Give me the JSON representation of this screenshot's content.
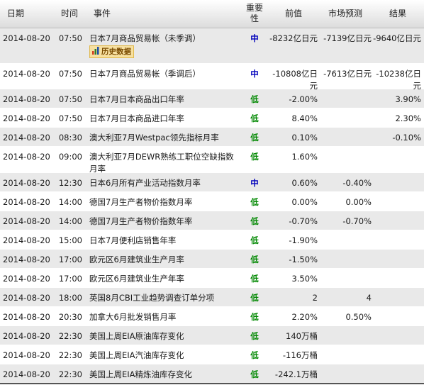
{
  "columns": {
    "date": "日期",
    "time": "时间",
    "event": "事件",
    "importance": "重要性",
    "previous": "前值",
    "forecast": "市场预测",
    "actual": "结果"
  },
  "history_label": "历史数据",
  "importance_colors": {
    "high": "#0000bb",
    "low": "#008800"
  },
  "rows": [
    {
      "date": "2014-08-20",
      "time": "07:50",
      "event": "日本7月商品贸易帐（未季调）",
      "importance": "中",
      "level": "high",
      "previous": "-8232亿日元",
      "forecast": "-7139亿日元",
      "actual": "-9640亿日元",
      "history": true
    },
    {
      "date": "2014-08-20",
      "time": "07:50",
      "event": "日本7月商品贸易帐（季调后）",
      "importance": "中",
      "level": "high",
      "previous": "-10808亿日元",
      "forecast": "-7613亿日元",
      "actual": "-10238亿日元"
    },
    {
      "date": "2014-08-20",
      "time": "07:50",
      "event": "日本7月日本商品出口年率",
      "importance": "低",
      "level": "low",
      "previous": "-2.00%",
      "forecast": "",
      "actual": "3.90%"
    },
    {
      "date": "2014-08-20",
      "time": "07:50",
      "event": "日本7月日本商品进口年率",
      "importance": "低",
      "level": "low",
      "previous": "8.40%",
      "forecast": "",
      "actual": "2.30%"
    },
    {
      "date": "2014-08-20",
      "time": "08:30",
      "event": "澳大利亚7月Westpac领先指标月率",
      "importance": "低",
      "level": "low",
      "previous": "0.10%",
      "forecast": "",
      "actual": "-0.10%"
    },
    {
      "date": "2014-08-20",
      "time": "09:00",
      "event": "澳大利亚7月DEWR熟练工职位空缺指数月率",
      "importance": "低",
      "level": "low",
      "previous": "1.60%",
      "forecast": "",
      "actual": ""
    },
    {
      "date": "2014-08-20",
      "time": "12:30",
      "event": "日本6月所有产业活动指数月率",
      "importance": "中",
      "level": "high",
      "previous": "0.60%",
      "forecast": "-0.40%",
      "actual": ""
    },
    {
      "date": "2014-08-20",
      "time": "14:00",
      "event": "德国7月生产者物价指数月率",
      "importance": "低",
      "level": "low",
      "previous": "0.00%",
      "forecast": "0.00%",
      "actual": ""
    },
    {
      "date": "2014-08-20",
      "time": "14:00",
      "event": "德国7月生产者物价指数年率",
      "importance": "低",
      "level": "low",
      "previous": "-0.70%",
      "forecast": "-0.70%",
      "actual": ""
    },
    {
      "date": "2014-08-20",
      "time": "15:00",
      "event": "日本7月便利店销售年率",
      "importance": "低",
      "level": "low",
      "previous": "-1.90%",
      "forecast": "",
      "actual": ""
    },
    {
      "date": "2014-08-20",
      "time": "17:00",
      "event": "欧元区6月建筑业生产月率",
      "importance": "低",
      "level": "low",
      "previous": "-1.50%",
      "forecast": "",
      "actual": ""
    },
    {
      "date": "2014-08-20",
      "time": "17:00",
      "event": "欧元区6月建筑业生产年率",
      "importance": "低",
      "level": "low",
      "previous": "3.50%",
      "forecast": "",
      "actual": ""
    },
    {
      "date": "2014-08-20",
      "time": "18:00",
      "event": "英国8月CBI工业趋势调查订单分项",
      "importance": "低",
      "level": "low",
      "previous": "2",
      "forecast": "4",
      "actual": ""
    },
    {
      "date": "2014-08-20",
      "time": "20:30",
      "event": "加拿大6月批发销售月率",
      "importance": "低",
      "level": "low",
      "previous": "2.20%",
      "forecast": "0.50%",
      "actual": ""
    },
    {
      "date": "2014-08-20",
      "time": "22:30",
      "event": "美国上周EIA原油库存变化",
      "importance": "低",
      "level": "low",
      "previous": "140万桶",
      "forecast": "",
      "actual": ""
    },
    {
      "date": "2014-08-20",
      "time": "22:30",
      "event": "美国上周EIA汽油库存变化",
      "importance": "低",
      "level": "low",
      "previous": "-116万桶",
      "forecast": "",
      "actual": ""
    },
    {
      "date": "2014-08-20",
      "time": "22:30",
      "event": "美国上周EIA精炼油库存变化",
      "importance": "低",
      "level": "low",
      "previous": "-242.1万桶",
      "forecast": "",
      "actual": ""
    }
  ]
}
